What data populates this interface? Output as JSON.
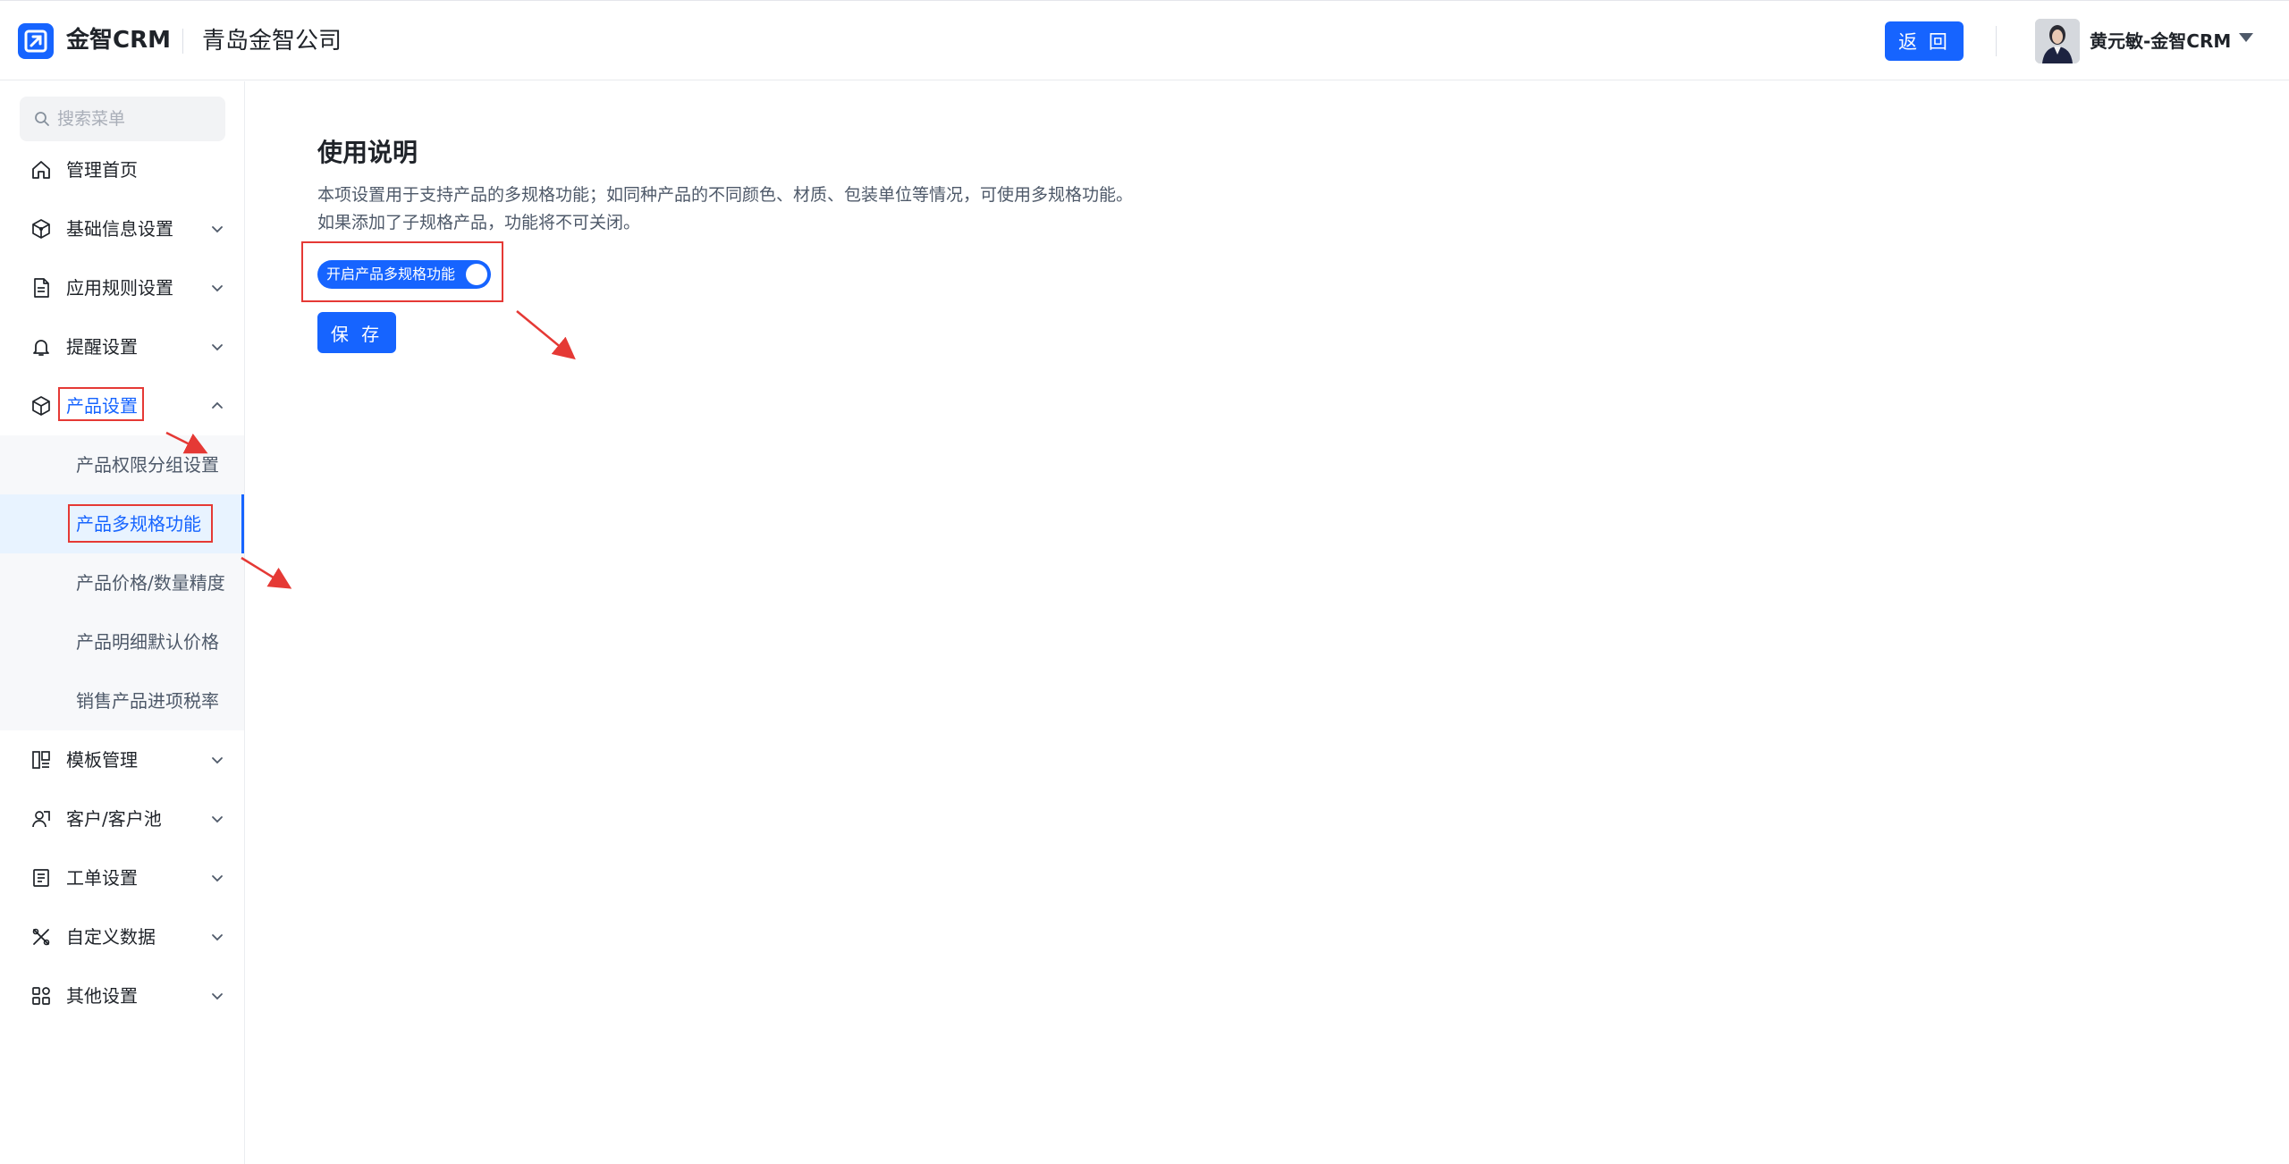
{
  "header": {
    "brand_name": "金智CRM",
    "company_name": "青岛金智公司",
    "back_label": "返 回",
    "user_name": "黄元敏-金智CRM"
  },
  "sidebar": {
    "search_placeholder": "搜索菜单",
    "items": [
      {
        "label": "管理首页",
        "icon": "home-icon"
      },
      {
        "label": "基础信息设置",
        "icon": "cube-icon"
      },
      {
        "label": "应用规则设置",
        "icon": "document-icon"
      },
      {
        "label": "提醒设置",
        "icon": "bell-icon"
      },
      {
        "label": "产品设置",
        "icon": "box-icon"
      },
      {
        "label": "模板管理",
        "icon": "template-icon"
      },
      {
        "label": "客户/客户池",
        "icon": "contacts-icon"
      },
      {
        "label": "工单设置",
        "icon": "ticket-icon"
      },
      {
        "label": "自定义数据",
        "icon": "tools-icon"
      },
      {
        "label": "其他设置",
        "icon": "apps-icon"
      }
    ],
    "product_sub_items": [
      {
        "label": "产品权限分组设置"
      },
      {
        "label": "产品多规格功能"
      },
      {
        "label": "产品价格/数量精度"
      },
      {
        "label": "产品明细默认价格"
      },
      {
        "label": "销售产品进项税率"
      }
    ]
  },
  "main": {
    "title": "使用说明",
    "desc_line1": "本项设置用于支持产品的多规格功能；如同种产品的不同颜色、材质、包装单位等情况，可使用多规格功能。",
    "desc_line2": "如果添加了子规格产品，功能将不可关闭。",
    "toggle_label": "开启产品多规格功能",
    "save_label": "保 存"
  },
  "colors": {
    "primary": "#1664ff",
    "annotation": "#e53935"
  }
}
